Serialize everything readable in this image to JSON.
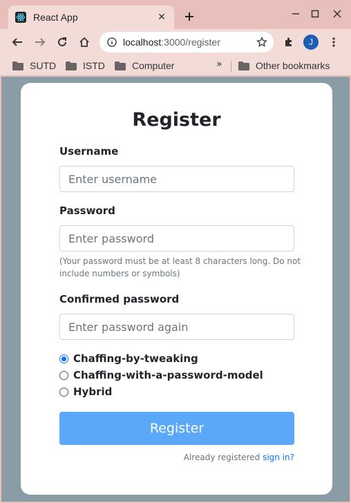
{
  "browser": {
    "tab_title": "React App",
    "url_host": "localhost",
    "url_path": ":3000/register",
    "avatar_letter": "J",
    "bookmarks": [
      "SUTD",
      "ISTD",
      "Computer"
    ],
    "more_bookmarks": "»",
    "other_bookmarks": "Other bookmarks",
    "accent_color": "#e8bfba"
  },
  "form": {
    "title": "Register",
    "username_label": "Username",
    "username_placeholder": "Enter username",
    "password_label": "Password",
    "password_placeholder": "Enter password",
    "password_help": "(Your password must be at least 8 characters long. Do not include numbers or symbols)",
    "confirm_label": "Confirmed password",
    "confirm_placeholder": "Enter password again",
    "options": [
      {
        "label": "Chaffing-by-tweaking",
        "checked": true
      },
      {
        "label": "Chaffing-with-a-password-model",
        "checked": false
      },
      {
        "label": "Hybrid",
        "checked": false
      }
    ],
    "submit_label": "Register",
    "footer_text": "Already registered ",
    "footer_link": "sign in?",
    "button_color": "#5aa8f7"
  }
}
